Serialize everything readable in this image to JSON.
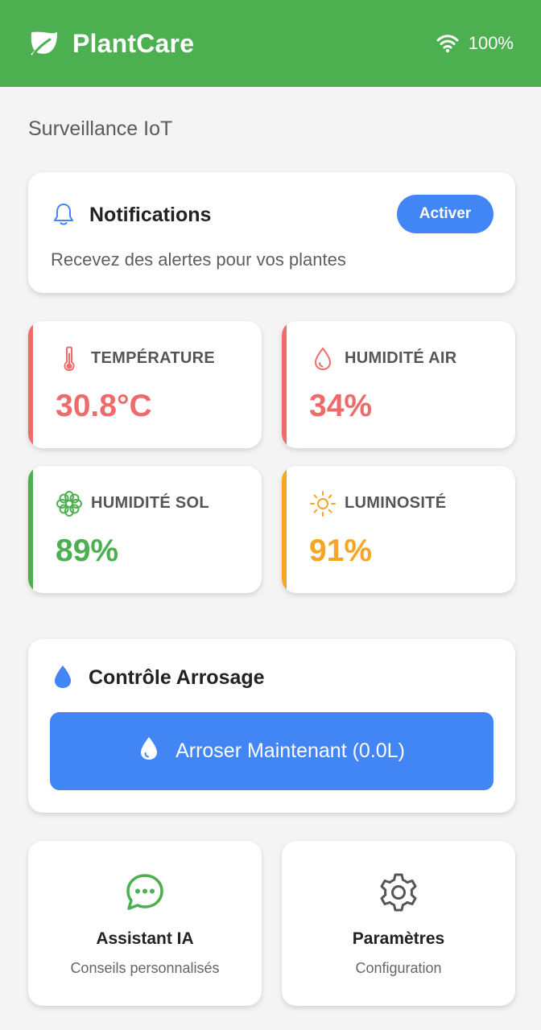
{
  "header": {
    "title": "PlantCare",
    "logo_icon": "leaf-icon",
    "battery": "100%",
    "wifi_icon": "wifi-icon"
  },
  "section_title": "Surveillance IoT",
  "notifications": {
    "title": "Notifications",
    "description": "Recevez des alertes pour vos plantes",
    "button_label": "Activer",
    "icon": "bell-icon"
  },
  "metrics": [
    {
      "label": "TEMPÉRATURE",
      "value": "30.8°C",
      "icon": "thermometer-icon",
      "color": "#ef6b6b"
    },
    {
      "label": "HUMIDITÉ AIR",
      "value": "34%",
      "icon": "droplet-icon",
      "color": "#ef6b6b"
    },
    {
      "label": "HUMIDITÉ SOL",
      "value": "89%",
      "icon": "flower-icon",
      "color": "#4caf50"
    },
    {
      "label": "LUMINOSITÉ",
      "value": "91%",
      "icon": "sun-icon",
      "color": "#f5a623"
    }
  ],
  "watering": {
    "title": "Contrôle Arrosage",
    "button_label": "Arroser Maintenant (0.0L)",
    "icon": "water-drop-icon"
  },
  "tiles": [
    {
      "title": "Assistant IA",
      "subtitle": "Conseils personnalisés",
      "icon": "chat-icon"
    },
    {
      "title": "Paramètres",
      "subtitle": "Configuration",
      "icon": "gear-icon"
    }
  ],
  "colors": {
    "primary_green": "#4caf50",
    "accent_blue": "#4285f4",
    "danger_red": "#ef6b6b",
    "warning_orange": "#f5a623"
  }
}
